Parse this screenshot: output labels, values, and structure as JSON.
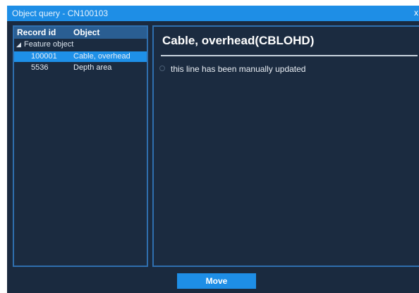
{
  "window": {
    "title": "Object query - CN100103",
    "close_glyph": "x"
  },
  "tree": {
    "headers": {
      "record_id": "Record id",
      "object": "Object"
    },
    "group": {
      "label": "Feature object",
      "expand_glyph": "◢",
      "expanded": true
    },
    "rows": [
      {
        "record_id": "100001",
        "object": "Cable, overhead",
        "selected": true
      },
      {
        "record_id": "5536",
        "object": "Depth area",
        "selected": false
      }
    ]
  },
  "details": {
    "title": "Cable, overhead(CBLOHD)",
    "attributes": [
      {
        "text": "this line has been manually updated"
      }
    ]
  },
  "footer": {
    "move_label": "Move"
  },
  "colors": {
    "accent": "#1e8ee6",
    "background": "#1a2a3f",
    "panel_border": "#2f6fae",
    "header_bg": "#2a5e92"
  },
  "icons": {
    "close": "close-icon",
    "expand": "expand-triangle-icon",
    "attribute_bullet": "radio-circle-icon"
  }
}
